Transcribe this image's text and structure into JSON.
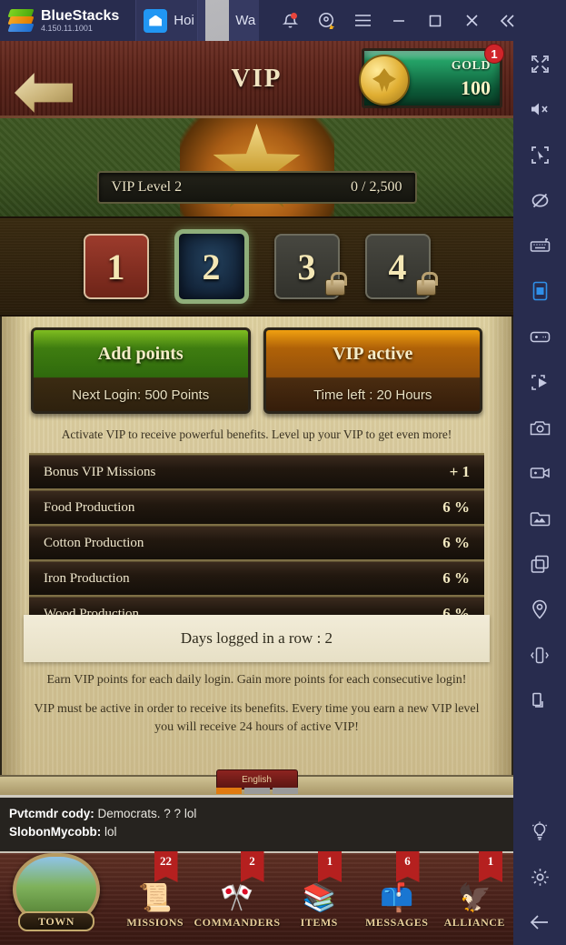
{
  "titlebar": {
    "brand": "BlueStacks",
    "version": "4.150.11.1001",
    "tabs": [
      {
        "label": "Hoi",
        "icon": "home-icon"
      },
      {
        "label": "Wa",
        "icon": "game-thumb-icon"
      }
    ],
    "buttons": [
      {
        "name": "notifications-icon"
      },
      {
        "name": "location-star-icon"
      },
      {
        "name": "menu-icon"
      },
      {
        "name": "minimize-icon"
      },
      {
        "name": "maximize-icon"
      },
      {
        "name": "close-icon"
      },
      {
        "name": "collapse-sidebar-icon"
      }
    ]
  },
  "sidebar": {
    "items": [
      "fullscreen-icon",
      "mute-icon",
      "cursor-select-icon",
      "eyeslash-icon",
      "keyboard-icon",
      "rotate-portrait-icon",
      "gamepad-icon",
      "macro-play-icon",
      "screenshot-icon",
      "record-video-icon",
      "media-gallery-icon",
      "multi-instance-icon",
      "location-pin-icon",
      "shake-icon",
      "resize-window-icon"
    ],
    "bottom_items": [
      "lightbulb-icon",
      "gear-icon",
      "back-arrow-icon"
    ]
  },
  "game": {
    "header": {
      "title": "VIP",
      "back_icon": "back-arrow-icon",
      "gold": {
        "label": "GOLD",
        "value": "100",
        "badge": "1",
        "icon": "gold-coin-icon"
      }
    },
    "level_bar": {
      "level_label": "VIP Level 2",
      "progress_label": "0 / 2,500",
      "current": 0,
      "max": 2500
    },
    "tiles": [
      {
        "label": "1",
        "state": "done",
        "locked": false
      },
      {
        "label": "2",
        "state": "current",
        "locked": false
      },
      {
        "label": "3",
        "state": "locked",
        "locked": true
      },
      {
        "label": "4",
        "state": "locked",
        "locked": true
      }
    ],
    "buttons": {
      "add_points": {
        "title": "Add points",
        "subtitle": "Next Login: 500 Points",
        "color": "#3f7d10"
      },
      "vip_active": {
        "title": "VIP active",
        "subtitle": "Time left : 20 Hours",
        "color": "#b06208"
      }
    },
    "blurb": "Activate VIP to receive powerful benefits. Level up your VIP to get even more!",
    "benefits": [
      {
        "name": "Bonus VIP Missions",
        "value": "+ 1"
      },
      {
        "name": "Food Production",
        "value": "6 %"
      },
      {
        "name": "Cotton Production",
        "value": "6 %"
      },
      {
        "name": "Iron Production",
        "value": "6 %"
      },
      {
        "name": "Wood Production",
        "value": "6 %"
      }
    ],
    "days_card": "Days logged in a row : 2",
    "notes": [
      "Earn VIP points for each daily login. Gain more points for each consecutive login!",
      "VIP must be active in order to receive its benefits. Every time you earn a new VIP level you will receive 24 hours of active VIP!"
    ],
    "language_chip": "English",
    "chat": [
      {
        "user": "Pvtcmdr cody:",
        "text": " Democrats. ? ?   lol"
      },
      {
        "user": "SlobonMycobb:",
        "text": " lol"
      }
    ],
    "nav": [
      {
        "label": "TOWN",
        "badge": "",
        "icon": "town-icon"
      },
      {
        "label": "MISSIONS",
        "badge": "22",
        "icon": "scroll-quill-icon"
      },
      {
        "label": "COMMANDERS",
        "badge": "2",
        "icon": "crossed-flags-icon"
      },
      {
        "label": "ITEMS",
        "badge": "1",
        "icon": "satchel-icon"
      },
      {
        "label": "MESSAGES",
        "badge": "6",
        "icon": "mailbox-icon"
      },
      {
        "label": "ALLIANCE",
        "badge": "1",
        "icon": "winged-crest-icon"
      }
    ]
  }
}
